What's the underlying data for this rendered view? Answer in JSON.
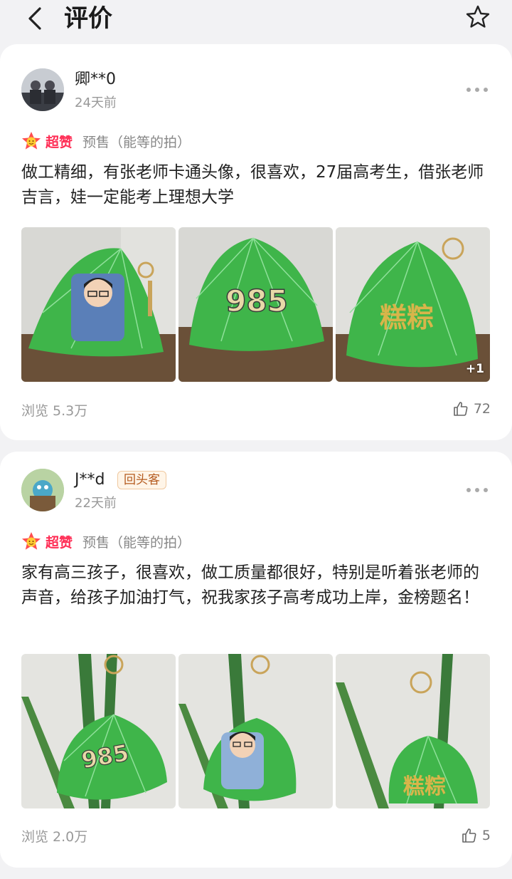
{
  "header": {
    "title": "评价"
  },
  "reviews": [
    {
      "username": "卿**0",
      "time": "24天前",
      "badge": "",
      "rating_label": "超赞",
      "presale": "预售（能等的拍）",
      "text": "做工精细，有张老师卡通头像，很喜欢，27届高考生，借张老师吉言，娃一定能考上理想大学",
      "photo_texts": [
        "",
        "985",
        "糕粽"
      ],
      "more_photos": "+1",
      "views": "浏览 5.3万",
      "likes": "72"
    },
    {
      "username": "J**d",
      "time": "22天前",
      "badge": "回头客",
      "rating_label": "超赞",
      "presale": "预售（能等的拍）",
      "text": "家有高三孩子，很喜欢，做工质量都很好，特别是听着张老师的声音，给孩子加油打气，祝我家孩子高考成功上岸，金榜题名！",
      "photo_texts": [
        "985",
        "",
        "糕粽"
      ],
      "more_photos": "",
      "views": "浏览 2.0万",
      "likes": "5"
    }
  ],
  "colors": {
    "accent": "#ff2d55",
    "plush_green": "#3fb54a",
    "badge_text": "#b45a1e"
  }
}
